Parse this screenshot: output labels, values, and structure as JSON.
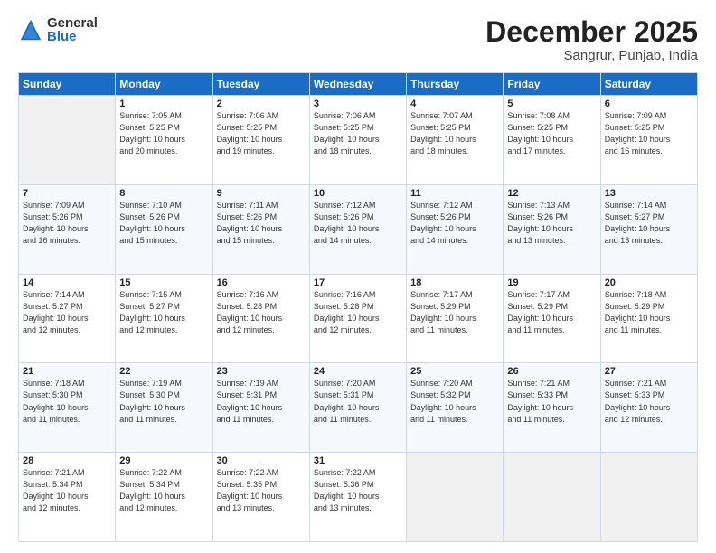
{
  "logo": {
    "general": "General",
    "blue": "Blue"
  },
  "header": {
    "month": "December 2025",
    "location": "Sangrur, Punjab, India"
  },
  "days_of_week": [
    "Sunday",
    "Monday",
    "Tuesday",
    "Wednesday",
    "Thursday",
    "Friday",
    "Saturday"
  ],
  "weeks": [
    [
      {
        "day": "",
        "info": ""
      },
      {
        "day": "1",
        "info": "Sunrise: 7:05 AM\nSunset: 5:25 PM\nDaylight: 10 hours\nand 20 minutes."
      },
      {
        "day": "2",
        "info": "Sunrise: 7:06 AM\nSunset: 5:25 PM\nDaylight: 10 hours\nand 19 minutes."
      },
      {
        "day": "3",
        "info": "Sunrise: 7:06 AM\nSunset: 5:25 PM\nDaylight: 10 hours\nand 18 minutes."
      },
      {
        "day": "4",
        "info": "Sunrise: 7:07 AM\nSunset: 5:25 PM\nDaylight: 10 hours\nand 18 minutes."
      },
      {
        "day": "5",
        "info": "Sunrise: 7:08 AM\nSunset: 5:25 PM\nDaylight: 10 hours\nand 17 minutes."
      },
      {
        "day": "6",
        "info": "Sunrise: 7:09 AM\nSunset: 5:25 PM\nDaylight: 10 hours\nand 16 minutes."
      }
    ],
    [
      {
        "day": "7",
        "info": "Sunrise: 7:09 AM\nSunset: 5:26 PM\nDaylight: 10 hours\nand 16 minutes."
      },
      {
        "day": "8",
        "info": "Sunrise: 7:10 AM\nSunset: 5:26 PM\nDaylight: 10 hours\nand 15 minutes."
      },
      {
        "day": "9",
        "info": "Sunrise: 7:11 AM\nSunset: 5:26 PM\nDaylight: 10 hours\nand 15 minutes."
      },
      {
        "day": "10",
        "info": "Sunrise: 7:12 AM\nSunset: 5:26 PM\nDaylight: 10 hours\nand 14 minutes."
      },
      {
        "day": "11",
        "info": "Sunrise: 7:12 AM\nSunset: 5:26 PM\nDaylight: 10 hours\nand 14 minutes."
      },
      {
        "day": "12",
        "info": "Sunrise: 7:13 AM\nSunset: 5:26 PM\nDaylight: 10 hours\nand 13 minutes."
      },
      {
        "day": "13",
        "info": "Sunrise: 7:14 AM\nSunset: 5:27 PM\nDaylight: 10 hours\nand 13 minutes."
      }
    ],
    [
      {
        "day": "14",
        "info": "Sunrise: 7:14 AM\nSunset: 5:27 PM\nDaylight: 10 hours\nand 12 minutes."
      },
      {
        "day": "15",
        "info": "Sunrise: 7:15 AM\nSunset: 5:27 PM\nDaylight: 10 hours\nand 12 minutes."
      },
      {
        "day": "16",
        "info": "Sunrise: 7:16 AM\nSunset: 5:28 PM\nDaylight: 10 hours\nand 12 minutes."
      },
      {
        "day": "17",
        "info": "Sunrise: 7:16 AM\nSunset: 5:28 PM\nDaylight: 10 hours\nand 12 minutes."
      },
      {
        "day": "18",
        "info": "Sunrise: 7:17 AM\nSunset: 5:29 PM\nDaylight: 10 hours\nand 11 minutes."
      },
      {
        "day": "19",
        "info": "Sunrise: 7:17 AM\nSunset: 5:29 PM\nDaylight: 10 hours\nand 11 minutes."
      },
      {
        "day": "20",
        "info": "Sunrise: 7:18 AM\nSunset: 5:29 PM\nDaylight: 10 hours\nand 11 minutes."
      }
    ],
    [
      {
        "day": "21",
        "info": "Sunrise: 7:18 AM\nSunset: 5:30 PM\nDaylight: 10 hours\nand 11 minutes."
      },
      {
        "day": "22",
        "info": "Sunrise: 7:19 AM\nSunset: 5:30 PM\nDaylight: 10 hours\nand 11 minutes."
      },
      {
        "day": "23",
        "info": "Sunrise: 7:19 AM\nSunset: 5:31 PM\nDaylight: 10 hours\nand 11 minutes."
      },
      {
        "day": "24",
        "info": "Sunrise: 7:20 AM\nSunset: 5:31 PM\nDaylight: 10 hours\nand 11 minutes."
      },
      {
        "day": "25",
        "info": "Sunrise: 7:20 AM\nSunset: 5:32 PM\nDaylight: 10 hours\nand 11 minutes."
      },
      {
        "day": "26",
        "info": "Sunrise: 7:21 AM\nSunset: 5:33 PM\nDaylight: 10 hours\nand 11 minutes."
      },
      {
        "day": "27",
        "info": "Sunrise: 7:21 AM\nSunset: 5:33 PM\nDaylight: 10 hours\nand 12 minutes."
      }
    ],
    [
      {
        "day": "28",
        "info": "Sunrise: 7:21 AM\nSunset: 5:34 PM\nDaylight: 10 hours\nand 12 minutes."
      },
      {
        "day": "29",
        "info": "Sunrise: 7:22 AM\nSunset: 5:34 PM\nDaylight: 10 hours\nand 12 minutes."
      },
      {
        "day": "30",
        "info": "Sunrise: 7:22 AM\nSunset: 5:35 PM\nDaylight: 10 hours\nand 13 minutes."
      },
      {
        "day": "31",
        "info": "Sunrise: 7:22 AM\nSunset: 5:36 PM\nDaylight: 10 hours\nand 13 minutes."
      },
      {
        "day": "",
        "info": ""
      },
      {
        "day": "",
        "info": ""
      },
      {
        "day": "",
        "info": ""
      }
    ]
  ]
}
